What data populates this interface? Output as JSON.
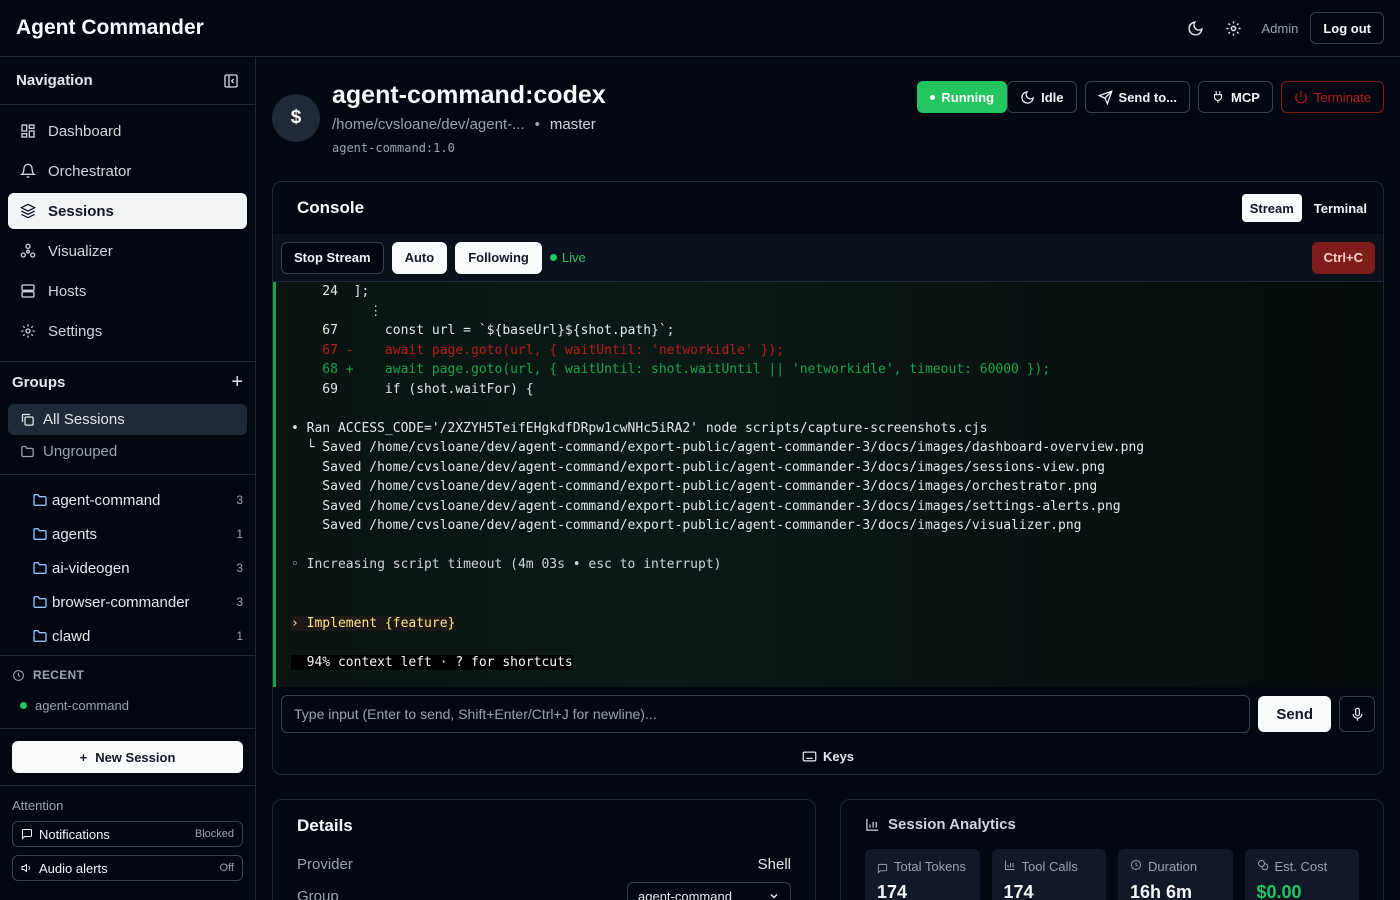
{
  "app": {
    "title": "Agent Commander"
  },
  "topbar": {
    "user": "Admin",
    "logout": "Log out"
  },
  "sidebar": {
    "nav_title": "Navigation",
    "nav": [
      {
        "label": "Dashboard",
        "icon": "dashboard-icon"
      },
      {
        "label": "Orchestrator",
        "icon": "bell-icon"
      },
      {
        "label": "Sessions",
        "icon": "layers-icon",
        "active": true
      },
      {
        "label": "Visualizer",
        "icon": "network-icon"
      },
      {
        "label": "Hosts",
        "icon": "server-icon"
      },
      {
        "label": "Settings",
        "icon": "gear-icon"
      }
    ],
    "groups_title": "Groups",
    "groups_top": [
      {
        "label": "All Sessions",
        "active": true
      },
      {
        "label": "Ungrouped"
      }
    ],
    "groups": [
      {
        "label": "agent-command",
        "count": "3"
      },
      {
        "label": "agents",
        "count": "1"
      },
      {
        "label": "ai-videogen",
        "count": "3"
      },
      {
        "label": "browser-commander",
        "count": "3"
      },
      {
        "label": "clawd",
        "count": "1"
      }
    ],
    "recent_title": "RECENT",
    "recent": [
      {
        "label": "agent-command"
      }
    ],
    "new_session": "New Session",
    "attention_title": "Attention",
    "attention": [
      {
        "label": "Notifications",
        "status": "Blocked"
      },
      {
        "label": "Audio alerts",
        "status": "Off"
      }
    ]
  },
  "session": {
    "avatar": "$",
    "title": "agent-command:codex",
    "path": "/home/cvsloane/dev/agent-...",
    "separator": "•",
    "branch": "master",
    "image": "agent-command:1.0",
    "actions": {
      "running": "Running",
      "idle": "Idle",
      "send_to": "Send to...",
      "mcp": "MCP",
      "terminate": "Terminate"
    }
  },
  "console": {
    "title": "Console",
    "tabs": {
      "stream": "Stream",
      "terminal": "Terminal"
    },
    "toolbar": {
      "stop": "Stop Stream",
      "auto": "Auto",
      "following": "Following",
      "live": "Live",
      "ctrlc": "Ctrl+C"
    },
    "lines": [
      {
        "t": "    24  ];",
        "c": ""
      },
      {
        "t": "          ⋮",
        "c": ""
      },
      {
        "t": "    67      const url = `${baseUrl}${shot.path}`;",
        "c": ""
      },
      {
        "t": "    67 -    await page.goto(url, { waitUntil: 'networkidle' });",
        "c": "red"
      },
      {
        "t": "    68 +    await page.goto(url, { waitUntil: shot.waitUntil || 'networkidle', timeout: 60000 });",
        "c": "grn"
      },
      {
        "t": "    69      if (shot.waitFor) {",
        "c": ""
      },
      {
        "t": "",
        "c": ""
      },
      {
        "t": "• Ran ACCESS_CODE='/2XZYH5TeifEHgkdfDRpw1cwNHc5iRA2' node scripts/capture-screenshots.cjs",
        "c": ""
      },
      {
        "t": "  └ Saved /home/cvsloane/dev/agent-command/export-public/agent-commander-3/docs/images/dashboard-overview.png",
        "c": ""
      },
      {
        "t": "    Saved /home/cvsloane/dev/agent-command/export-public/agent-commander-3/docs/images/sessions-view.png",
        "c": ""
      },
      {
        "t": "    Saved /home/cvsloane/dev/agent-command/export-public/agent-commander-3/docs/images/orchestrator.png",
        "c": ""
      },
      {
        "t": "    Saved /home/cvsloane/dev/agent-command/export-public/agent-commander-3/docs/images/settings-alerts.png",
        "c": ""
      },
      {
        "t": "    Saved /home/cvsloane/dev/agent-command/export-public/agent-commander-3/docs/images/visualizer.png",
        "c": ""
      },
      {
        "t": "",
        "c": ""
      },
      {
        "t": "◦ Increasing script timeout (4m 03s • esc to interrupt)",
        "c": "dim"
      },
      {
        "t": "",
        "c": ""
      },
      {
        "t": "",
        "c": ""
      },
      {
        "t": "› Implement {feature}",
        "c": "hl"
      },
      {
        "t": "",
        "c": ""
      },
      {
        "t": "  94% context left · ? for shortcuts",
        "c": "inv"
      }
    ],
    "input_placeholder": "Type input (Enter to send, Shift+Enter/Ctrl+J for newline)...",
    "send": "Send",
    "keys": "Keys"
  },
  "details": {
    "title": "Details",
    "provider_label": "Provider",
    "provider_value": "Shell",
    "group_label": "Group",
    "group_value": "agent-command"
  },
  "analytics": {
    "title": "Session Analytics",
    "stats": [
      {
        "label": "Total Tokens",
        "value": "174"
      },
      {
        "label": "Tool Calls",
        "value": "174"
      },
      {
        "label": "Duration",
        "value": "16h 6m"
      },
      {
        "label": "Est. Cost",
        "value": "$0.00"
      }
    ]
  }
}
